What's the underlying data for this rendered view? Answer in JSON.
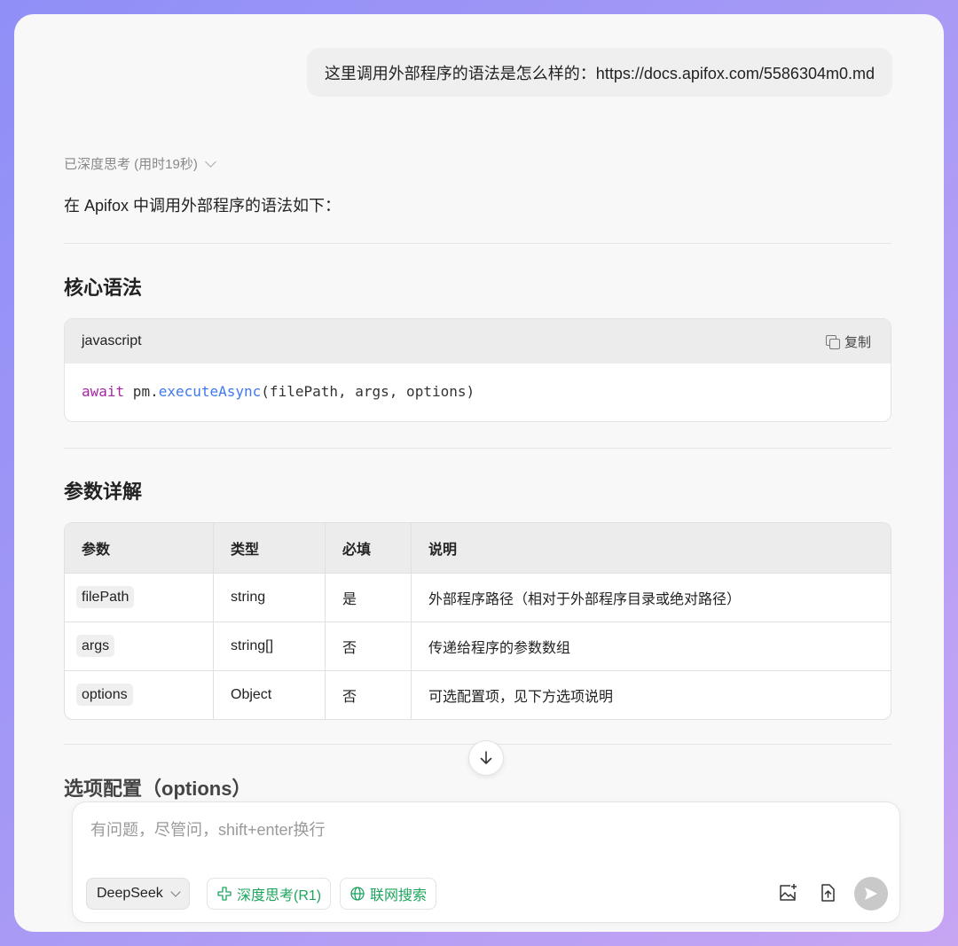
{
  "user_message": "这里调用外部程序的语法是怎么样的：https://docs.apifox.com/5586304m0.md",
  "assistant": {
    "thinking_label": "已深度思考 (用时19秒)",
    "intro": "在 Apifox 中调用外部程序的语法如下：",
    "section1_title": "核心语法",
    "code": {
      "language": "javascript",
      "copy_label": "复制",
      "tokens": {
        "keyword": "await",
        "obj": " pm.",
        "method": "executeAsync",
        "args": "(filePath, args, options)"
      }
    },
    "section2_title": "参数详解",
    "table": {
      "headers": [
        "参数",
        "类型",
        "必填",
        "说明"
      ],
      "rows": [
        {
          "param": "filePath",
          "type": "string",
          "required": "是",
          "desc": "外部程序路径（相对于外部程序目录或绝对路径）"
        },
        {
          "param": "args",
          "type": "string[]",
          "required": "否",
          "desc": "传递给程序的参数数组"
        },
        {
          "param": "options",
          "type": "Object",
          "required": "否",
          "desc": "可选配置项，见下方选项说明"
        }
      ]
    },
    "section3_title_partial": "选项配置（options）"
  },
  "composer": {
    "placeholder": "有问题，尽管问，shift+enter换行",
    "model": "DeepSeek",
    "deep_think_label": "深度思考(R1)",
    "web_search_label": "联网搜索"
  },
  "colors": {
    "accent_green": "#1ea55d",
    "keyword": "#a626a4",
    "function": "#4078f2"
  }
}
